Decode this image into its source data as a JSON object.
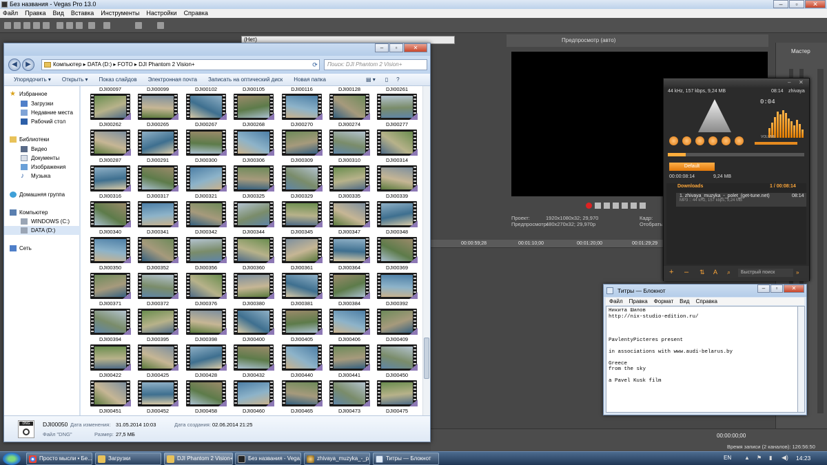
{
  "vegas": {
    "title": "Без названия - Vegas Pro 13.0",
    "menu": [
      "Файл",
      "Правка",
      "Вид",
      "Вставка",
      "Инструменты",
      "Настройки",
      "Справка"
    ],
    "none_dropdown": "(Нет)",
    "preview_mode": "Предпросмотр (авто)",
    "info_project_label": "Проект:",
    "info_project_value": "1920x1080x32; 29,970",
    "info_preview_label": "Предпросмотр:",
    "info_preview_value": "480x270x32; 29,970р",
    "info_frame_label": "Кадр:",
    "info_display_label": "Отобрать:",
    "ruler_times": [
      "00:00:59;28",
      "00:01:10;00",
      "00:01:20;00",
      "00:01:29;29"
    ],
    "master_label": "Мастер",
    "bottom_timecode": "00:00:00;00",
    "record_time": "Время записи (2 каналов): 126:56:50"
  },
  "explorer": {
    "breadcrumb": "Компьютер  ▸  DATA (D:)  ▸  FOTO  ▸  DJI Phantom 2 Vision+",
    "search_placeholder": "Поиск: DJI Phantom 2 Vision+",
    "commands": [
      "Упорядочить ▾",
      "Открыть ▾",
      "Показ слайдов",
      "Электронная почта",
      "Записать на оптический диск",
      "Новая папка"
    ],
    "nav": {
      "favorites": "Избранное",
      "downloads": "Загрузки",
      "recent": "Недавние места",
      "desktop": "Рабочий стол",
      "libraries": "Библиотеки",
      "video": "Видео",
      "documents": "Документы",
      "images": "Изображения",
      "music": "Музыка",
      "homegroup": "Домашняя группа",
      "computer": "Компьютер",
      "drive_c": "WINDOWS (C:)",
      "drive_d": "DATA (D:)",
      "network": "Сеть"
    },
    "top_row": [
      "DJI00097",
      "DJI00099",
      "DJI00102",
      "DJI00105",
      "DJI00116",
      "DJI00128",
      "DJI00261"
    ],
    "rows": [
      [
        "DJI00262",
        "DJI00265",
        "DJI00267",
        "DJI00268",
        "DJI00270",
        "DJI00274",
        "DJI00277"
      ],
      [
        "DJI00287",
        "DJI00291",
        "DJI00300",
        "DJI00306",
        "DJI00309",
        "DJI00310",
        "DJI00314"
      ],
      [
        "DJI00316",
        "DJI00317",
        "DJI00321",
        "DJI00325",
        "DJI00329",
        "DJI00335",
        "DJI00339"
      ],
      [
        "DJI00340",
        "DJI00341",
        "DJI00342",
        "DJI00344",
        "DJI00345",
        "DJI00347",
        "DJI00348"
      ],
      [
        "DJI00350",
        "DJI00352",
        "DJI00356",
        "DJI00360",
        "DJI00361",
        "DJI00364",
        "DJI00369"
      ],
      [
        "DJI00371",
        "DJI00372",
        "DJI00376",
        "DJI00380",
        "DJI00381",
        "DJI00384",
        "DJI00392"
      ],
      [
        "DJI00394",
        "DJI00395",
        "DJI00398",
        "DJI00400",
        "DJI00405",
        "DJI00406",
        "DJI00409"
      ],
      [
        "DJI00422",
        "DJI00425",
        "DJI00428",
        "DJI00432",
        "DJI00440",
        "DJI00441",
        "DJI00450"
      ],
      [
        "DJI00451",
        "DJI00452",
        "DJI00458",
        "DJI00460",
        "DJI00465",
        "DJI00473",
        "DJI00475"
      ]
    ],
    "details": {
      "badge": "DNG",
      "name": "DJI00050",
      "type": "Файл \"DNG\"",
      "modified_label": "Дата изменения:",
      "modified_value": "31.05.2014 10:03",
      "size_label": "Размер:",
      "size_value": "27,5 МБ",
      "created_label": "Дата создания:",
      "created_value": "02.06.2014 21:25"
    }
  },
  "aimp": {
    "info": "44 kHz, 157 kbps, 9,24 MB",
    "clock": "0:04",
    "time_short": "08:14",
    "artist_short": "zhivaya",
    "volume_label": "VOLUME",
    "tab": "Default",
    "stat_time": "00:00:08:14",
    "stat_size": "9,24 MB",
    "group": "Downloads",
    "group_count": "1 / 00:08:14",
    "track": "1. zhivaya_muzyka_-_polet_(get-tune.net)",
    "track_time": "08:14",
    "track_meta": "MP3 :: 44 kHz, 157 kbps, 9,24 MB",
    "search_placeholder": "Быстрый поиск"
  },
  "notepad": {
    "title": "Титры — Блокнот",
    "menu": [
      "Файл",
      "Правка",
      "Формат",
      "Вид",
      "Справка"
    ],
    "text": "Никита Шилов\nhttp://nix-studio-edition.ru/\n\n\n\nPavlentyPicteres present\n\nin associations with www.audi-belarus.by\n\nGreece\nfrom the sky\n\na Pavel Kusk film"
  },
  "taskbar": {
    "tasks": [
      "Просто мысли • Бе...",
      "Загрузки",
      "DJI Phantom 2 Vision+",
      "Без названия - Vega...",
      "zhivaya_muzyka_-_p...",
      "Титры — Блокнот"
    ],
    "lang": "EN",
    "clock": "14:23"
  }
}
